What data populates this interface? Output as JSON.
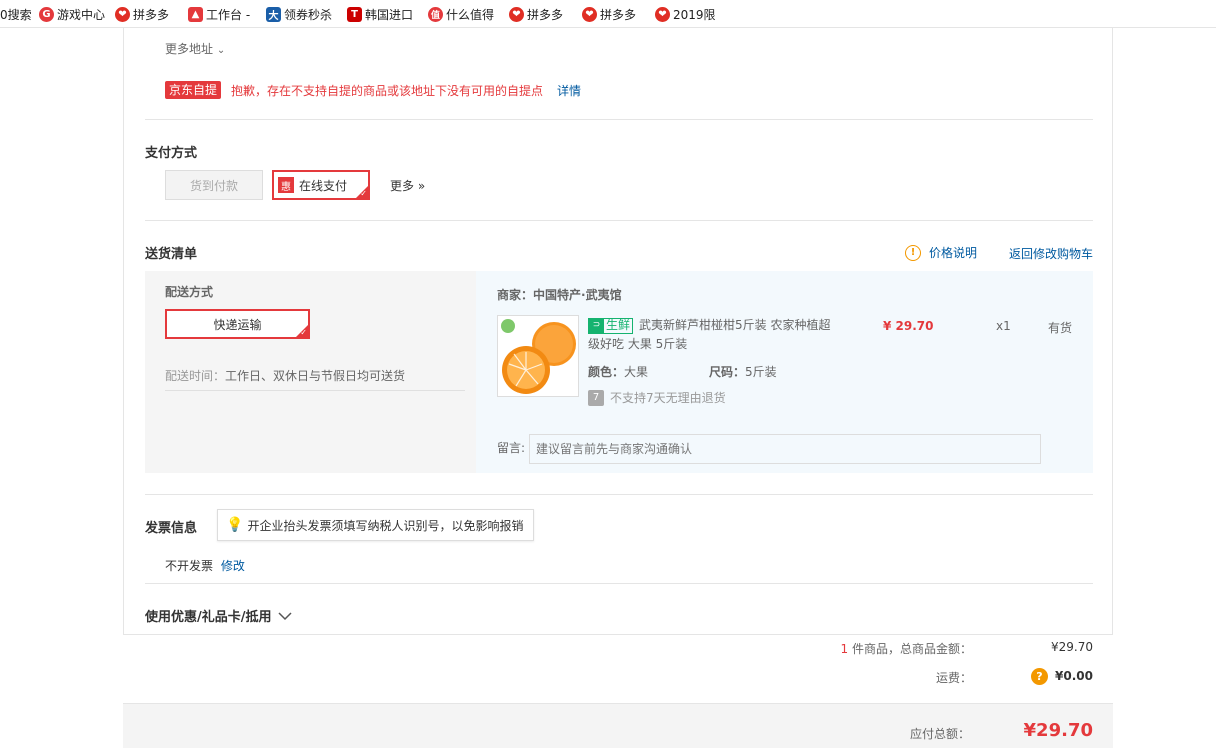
{
  "bookmarks": [
    {
      "label": "0搜索",
      "icon": "none"
    },
    {
      "label": "游戏中心",
      "icon": "game-center-icon",
      "color": "#e4393c",
      "glyph": "G"
    },
    {
      "label": "拼多多",
      "icon": "pinduoduo-icon",
      "color": "#e02e24",
      "glyph": "❤"
    },
    {
      "label": "工作台 -",
      "icon": "workbench-icon",
      "color": "#e4393c",
      "glyph": "👍"
    },
    {
      "label": "领券秒杀",
      "icon": "coupon-icon",
      "color": "#1a5ea8",
      "glyph": "大"
    },
    {
      "label": "韩国进口",
      "icon": "korea-import-icon",
      "color": "#c00",
      "glyph": "T"
    },
    {
      "label": "什么值得",
      "icon": "smzdm-icon",
      "color": "#e4393c",
      "glyph": "值"
    },
    {
      "label": "拼多多",
      "icon": "pinduoduo-icon",
      "color": "#e02e24",
      "glyph": "❤"
    },
    {
      "label": "拼多多",
      "icon": "pinduoduo-icon",
      "color": "#e02e24",
      "glyph": "❤"
    },
    {
      "label": "2019限",
      "icon": "pinduoduo-icon",
      "color": "#e02e24",
      "glyph": "❤"
    }
  ],
  "address": {
    "more_label": "更多地址",
    "pickup_tag": "京东自提",
    "pickup_warning": "抱歉，存在不支持自提的商品或该地址下没有可用的自提点",
    "details_link": "详情"
  },
  "payment": {
    "title": "支付方式",
    "cod_label": "货到付款",
    "online_badge": "惠",
    "online_label": "在线支付",
    "more_label": "更多 »"
  },
  "delivery": {
    "title": "送货清单",
    "price_note": "价格说明",
    "back_to_cart": "返回修改购物车",
    "method_title": "配送方式",
    "method_value": "快递运输",
    "time_label": "配送时间：",
    "time_value": "工作日、双休日与节假日均可送货",
    "merchant_label": "商家：",
    "merchant_name": "中国特产·武夷馆",
    "fresh_tag": "生鲜",
    "product_title": "武夷新鲜芦柑椪柑5斤装 农家种植超级好吃 大果 5斤装",
    "price": "¥ 29.70",
    "qty": "x1",
    "stock": "有货",
    "color_label": "颜色：",
    "color_value": "大果",
    "size_label": "尺码：",
    "size_value": "5斤装",
    "return_note": "不支持7天无理由退货",
    "return_icon_text": "7",
    "message_label": "留言:",
    "message_placeholder": "建议留言前先与商家沟通确认"
  },
  "invoice": {
    "title": "发票信息",
    "tip": "开企业抬头发票须填写纳税人识别号，以免影响报销",
    "value": "不开发票",
    "edit_link": "修改"
  },
  "coupon": {
    "title": "使用优惠/礼品卡/抵用"
  },
  "summary": {
    "count": "1",
    "count_suffix": "件商品，总商品金额：",
    "goods_total": "¥29.70",
    "shipping_label": "运费：",
    "shipping_value": "¥0.00",
    "payable_label": "应付总额：",
    "payable_value": "¥29.70"
  },
  "colors": {
    "accent": "#e4393c",
    "link": "#005aa0",
    "fresh": "#15b36f",
    "orange": "#f39800"
  }
}
